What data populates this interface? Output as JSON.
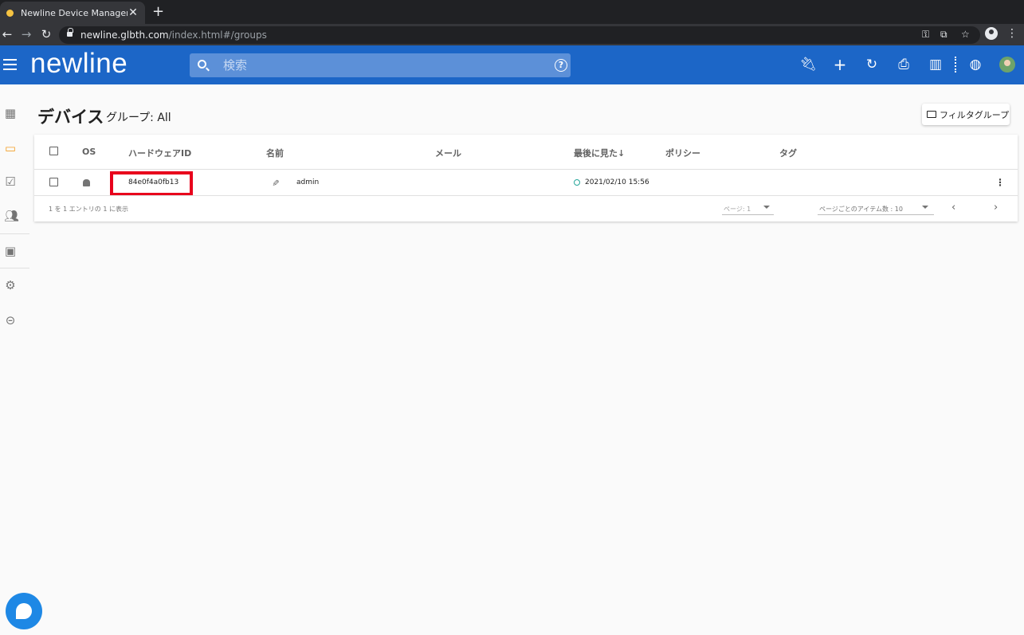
{
  "browser": {
    "tab_title": "Newline Device Management",
    "tab_close": "✕",
    "new_tab": "+",
    "url_domain": "newline.glbth.com",
    "url_path": "/index.html#/groups"
  },
  "header": {
    "logo": "newline",
    "search_placeholder": "検索",
    "help": "?"
  },
  "page": {
    "title": "デバイス",
    "group_label": "グループ: All",
    "filter_button": "フィルタグループ"
  },
  "table": {
    "columns": {
      "os": "OS",
      "hardware_id": "ハードウェアID",
      "name": "名前",
      "email": "メール",
      "last_seen": "最後に見た↓",
      "policy": "ポリシー",
      "tags": "タグ"
    },
    "rows": [
      {
        "hardware_id": "84e0f4a0fb13",
        "name": "admin",
        "email": "",
        "last_seen": "2021/02/10 15:56",
        "policy": "",
        "tags": ""
      }
    ],
    "footer": {
      "summary": "1 を 1 エントリの 1 に表示",
      "page_label": "ページ: 1",
      "items_per_page_label": "ページごとのアイテム数 : 10"
    }
  },
  "colors": {
    "brand_blue": "#1c66c7",
    "highlight_red": "#e8001c",
    "active_nav": "#f4a02a"
  }
}
